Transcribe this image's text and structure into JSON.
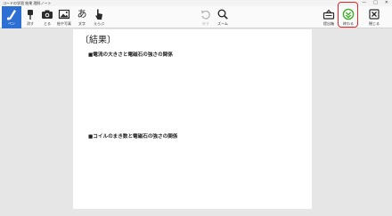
{
  "window": {
    "title": "コードの学習 結果 理科ノート",
    "controls": [
      "—",
      "□",
      "✕"
    ]
  },
  "toolbar": {
    "items": [
      {
        "label": "ペン",
        "icon": "pen-icon",
        "active": true
      },
      {
        "label": "消す",
        "icon": "eraser-icon"
      },
      {
        "label": "とる",
        "icon": "camera-icon"
      },
      {
        "label": "絵や写真",
        "icon": "image-icon"
      },
      {
        "label": "文字",
        "icon": "text-icon",
        "glyph": "あ"
      },
      {
        "label": "えらぶ",
        "icon": "pointer-hand-icon"
      },
      {
        "label": "戻す",
        "icon": "undo-icon",
        "disabled": true
      },
      {
        "label": "ズーム",
        "icon": "zoom-icon"
      },
      {
        "label": "提出箱",
        "icon": "submit-box-icon"
      },
      {
        "label": "終わる",
        "icon": "finish-icon"
      },
      {
        "label": "閉じる",
        "icon": "close-icon"
      }
    ]
  },
  "sheet": {
    "heading": "〔結果〕",
    "items": [
      "■電流の大きさと電磁石の強さの関係",
      "■コイルのまき数と電磁石の強さの関係"
    ]
  },
  "colors": {
    "accent": "#2e6fd3",
    "highlight": "#e02828",
    "finish": "#3fae2a"
  }
}
